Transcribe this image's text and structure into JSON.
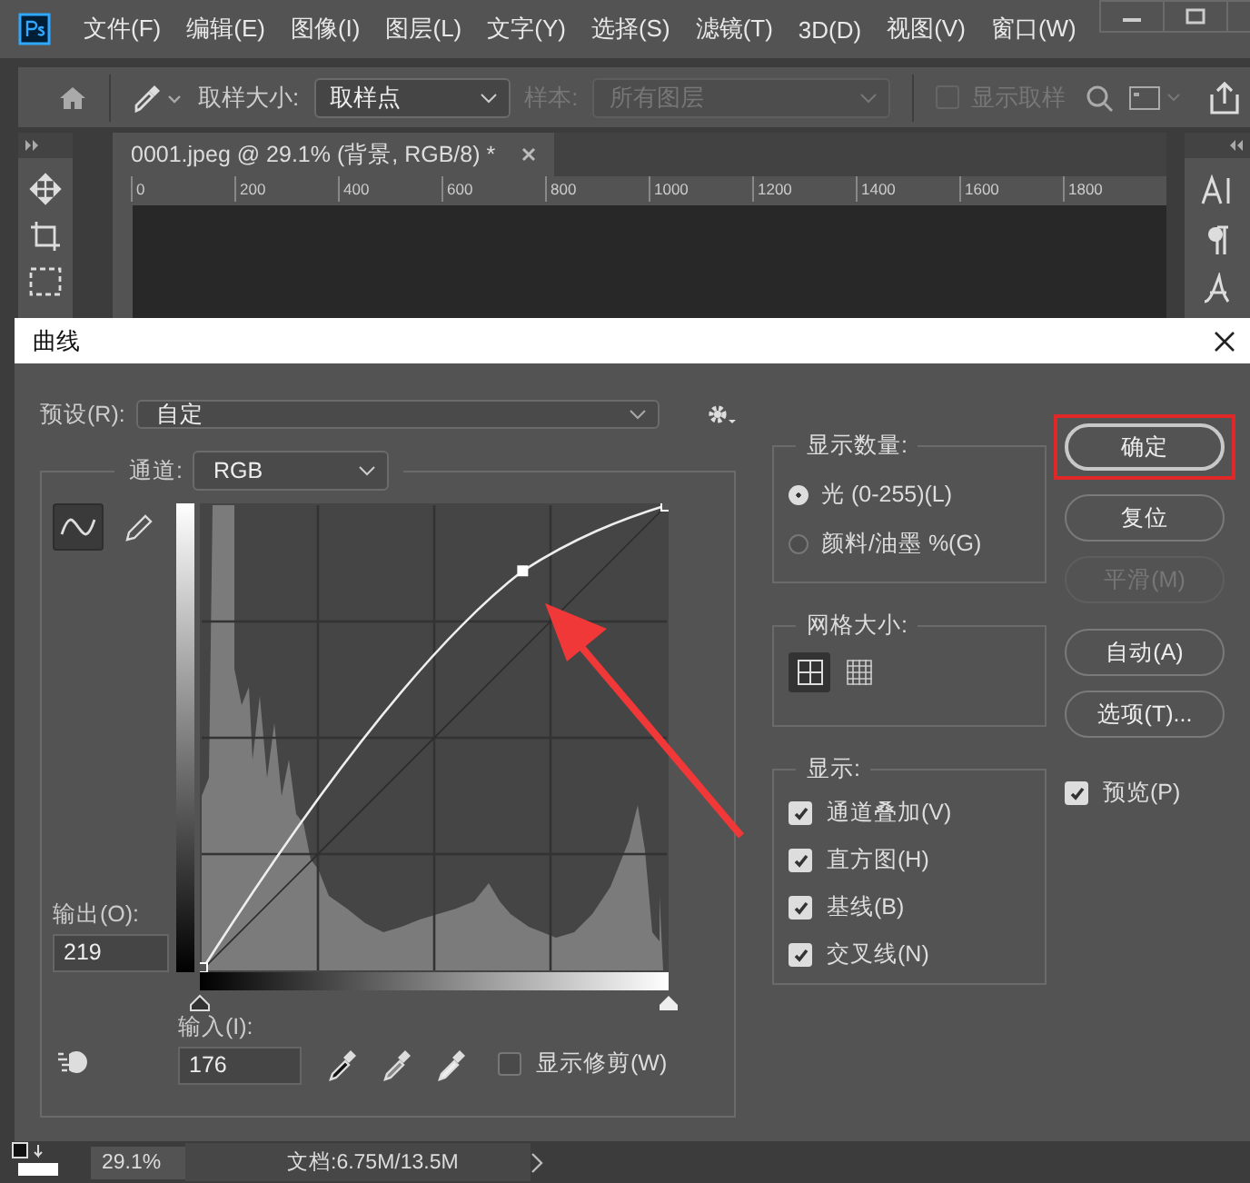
{
  "menu": [
    "文件(F)",
    "编辑(E)",
    "图像(I)",
    "图层(L)",
    "文字(Y)",
    "选择(S)",
    "滤镜(T)",
    "3D(D)",
    "视图(V)",
    "窗口(W)"
  ],
  "options_bar": {
    "sample_size_label": "取样大小:",
    "sample_size_value": "取样点",
    "sample_label": "样本:",
    "sample_value": "所有图层",
    "sample_disabled": true,
    "show_ring": {
      "label": "显示取样",
      "checked": false,
      "disabled": true
    }
  },
  "document": {
    "tab_title": "0001.jpeg @ 29.1% (背景, RGB/8) *",
    "ruler_labels": [
      "0",
      "200",
      "400",
      "600",
      "800",
      "1000",
      "1200",
      "1400",
      "1600",
      "1800"
    ]
  },
  "dialog": {
    "title": "曲线",
    "preset_label": "预设(R):",
    "preset_value": "自定",
    "channel_label": "通道:",
    "channel_value": "RGB",
    "tools": [
      {
        "kind": "curve",
        "selected": true
      },
      {
        "kind": "pencil",
        "selected": false
      }
    ],
    "shadow_slider": {
      "level": 0
    },
    "highlight_slider": {
      "level": 1
    },
    "output_label": "输出(O):",
    "output_value": "219",
    "input_label": "输入(I):",
    "input_value": "176",
    "show_clipping": {
      "label": "显示修剪(W)",
      "checked": false
    },
    "display_amount": {
      "title": "显示数量:",
      "options": [
        {
          "label": "光 (0-255)(L)",
          "selected": true
        },
        {
          "label": "颜料/油墨 %(G)",
          "selected": false
        }
      ]
    },
    "grid_size": {
      "title": "网格大小:",
      "options": [
        {
          "kind": "simple",
          "selected": true
        },
        {
          "kind": "detailed",
          "selected": false
        }
      ]
    },
    "show": {
      "title": "显示:",
      "options": [
        {
          "label": "通道叠加(V)",
          "checked": true
        },
        {
          "label": "直方图(H)",
          "checked": true
        },
        {
          "label": "基线(B)",
          "checked": true
        },
        {
          "label": "交叉线(N)",
          "checked": true
        }
      ]
    },
    "buttons": [
      {
        "label": "确定",
        "default": true,
        "disabled": false,
        "highlighted": true
      },
      {
        "label": "复位",
        "default": false,
        "disabled": false,
        "highlighted": false
      },
      {
        "label": "平滑(M)",
        "default": false,
        "disabled": true,
        "highlighted": false
      },
      {
        "label": "自动(A)",
        "default": false,
        "disabled": false,
        "highlighted": false
      },
      {
        "label": "选项(T)...",
        "default": false,
        "disabled": false,
        "highlighted": false
      }
    ],
    "preview": {
      "label": "预览(P)",
      "checked": true
    }
  },
  "status_bar": {
    "zoom": "29.1%",
    "doc_size": "文档:6.75M/13.5M"
  }
}
